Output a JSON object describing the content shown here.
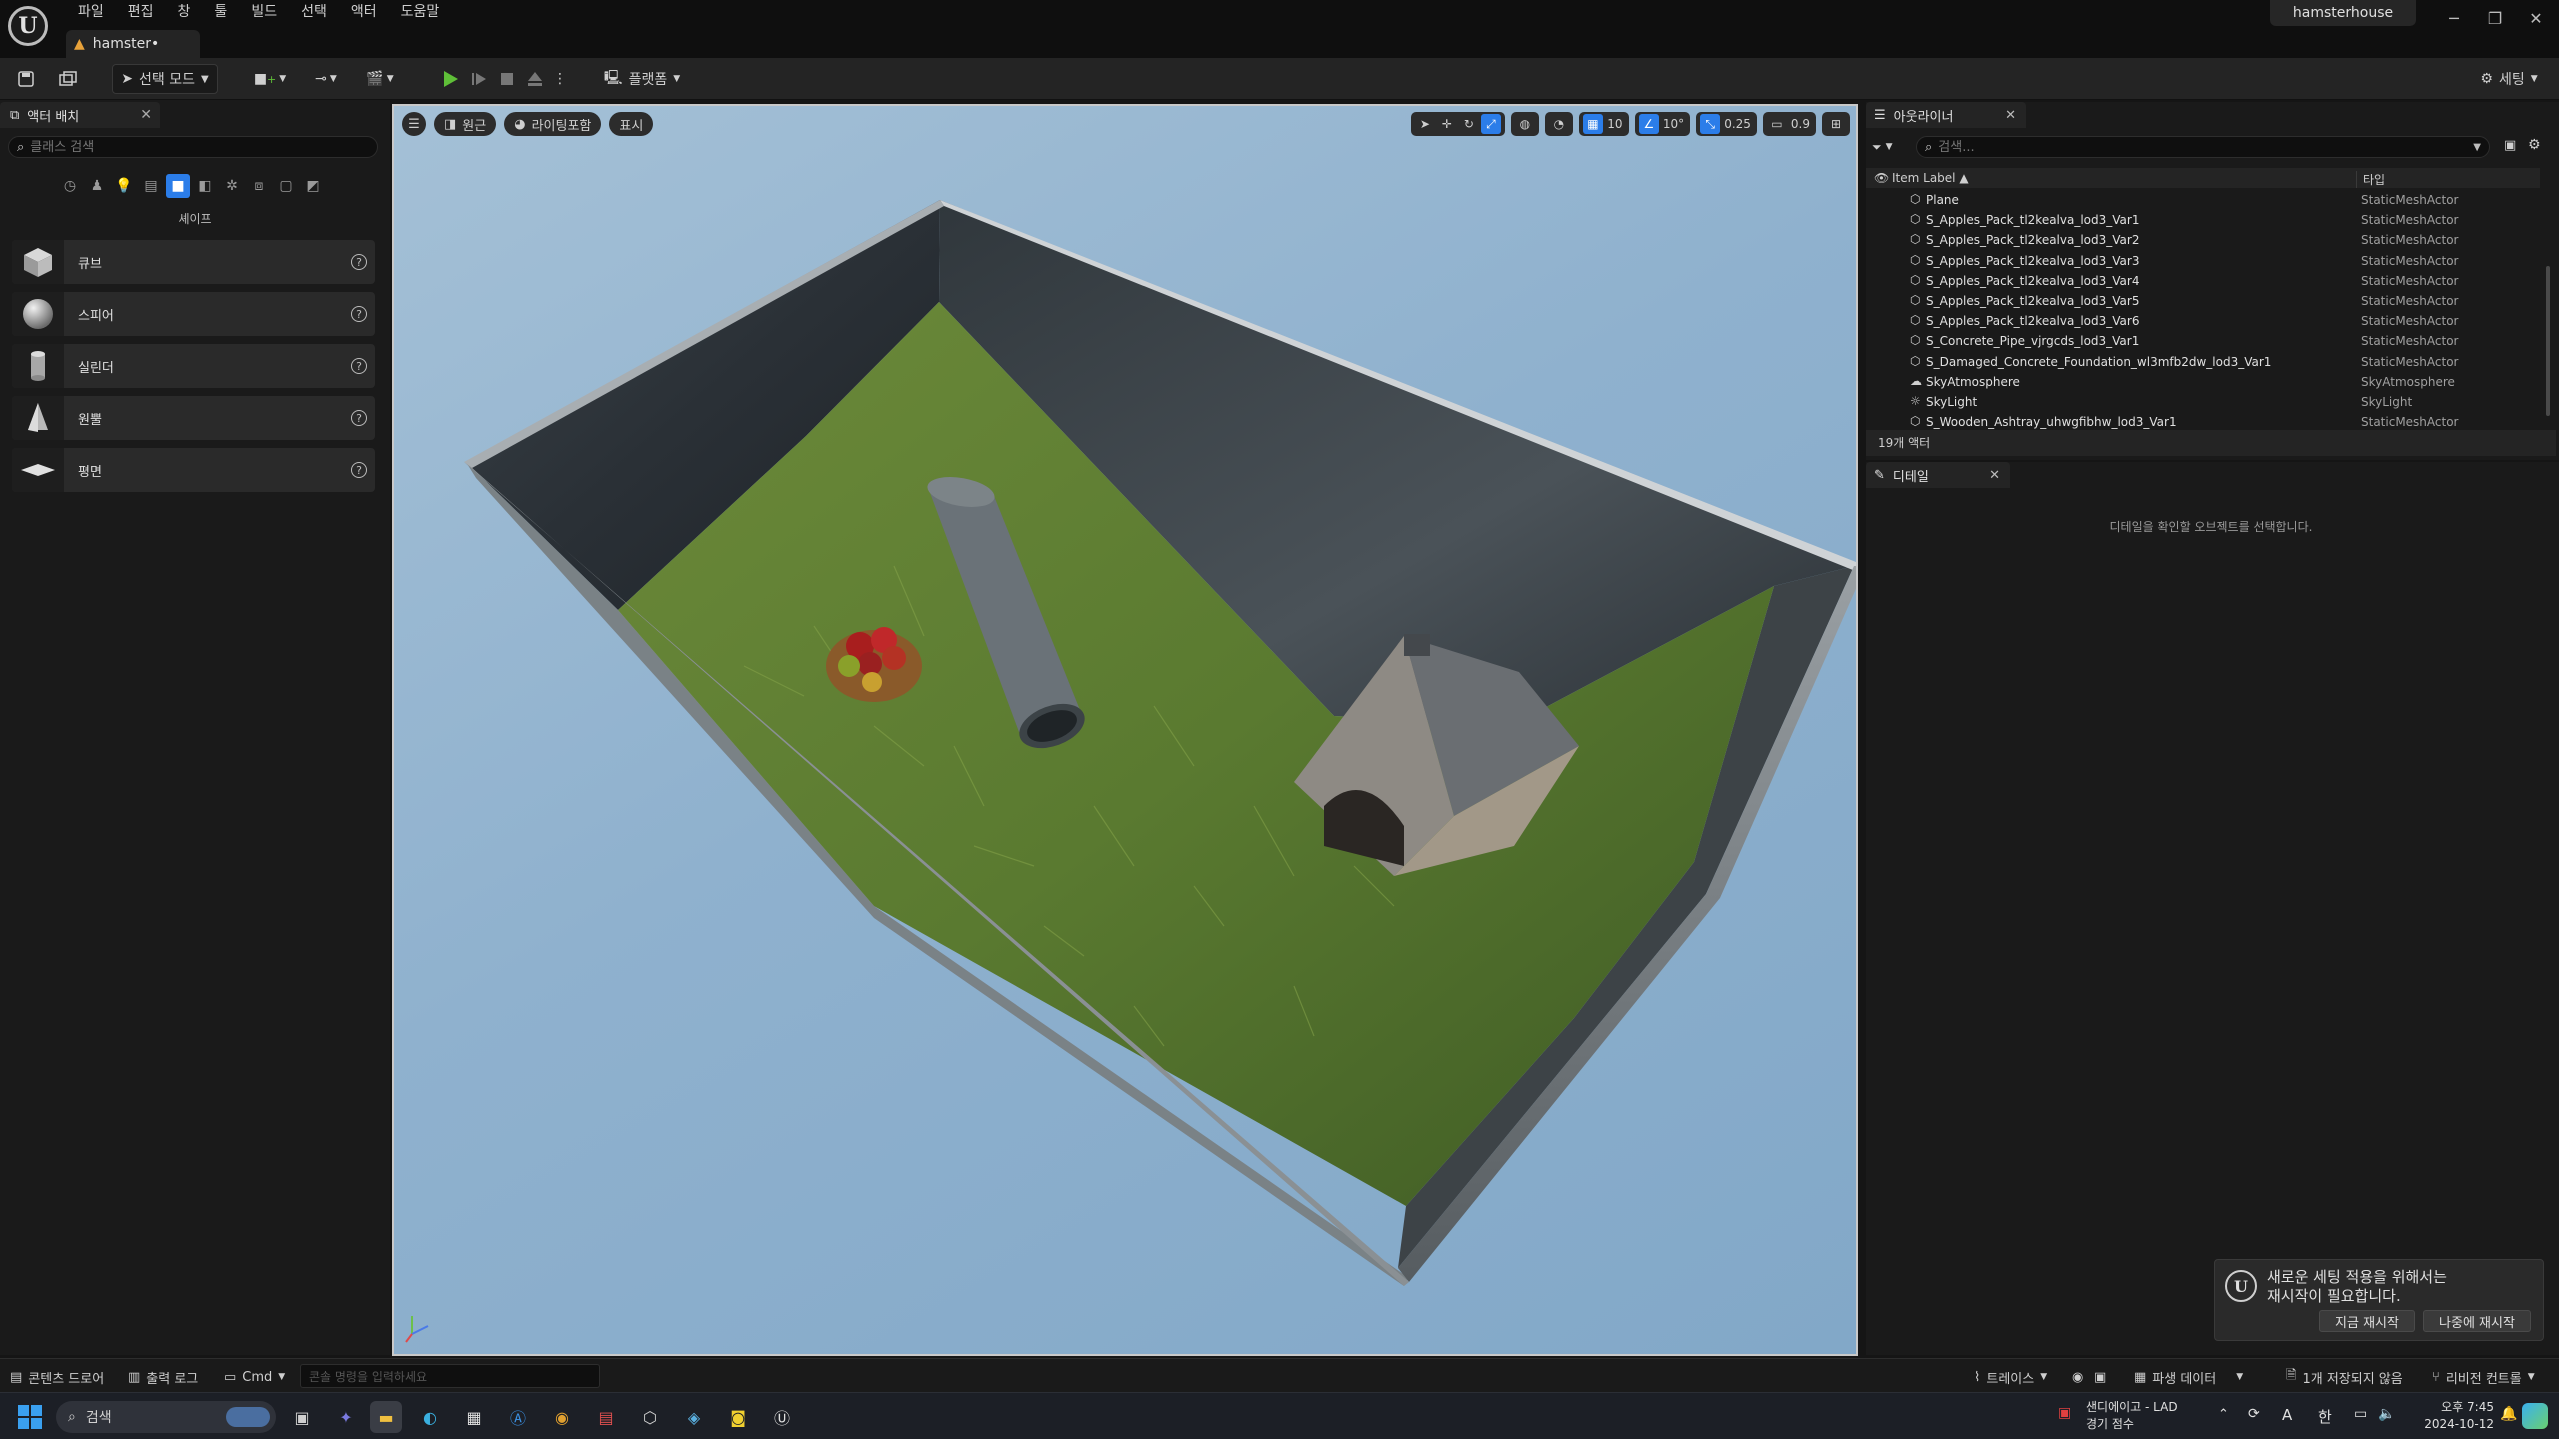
{
  "titlebar": {
    "menu": [
      "파일",
      "편집",
      "창",
      "툴",
      "빌드",
      "선택",
      "액터",
      "도움말"
    ],
    "project_tab": "hamster•",
    "project_name": "hamsterhouse"
  },
  "toolbar": {
    "select_mode": "선택 모드",
    "platforms": "플랫폼",
    "settings": "세팅"
  },
  "place_actors": {
    "tab_title": "액터 배치",
    "search_placeholder": "클래스 검색",
    "category_label": "셰이프",
    "shapes": [
      {
        "name": "큐브",
        "icon": "cube-icon"
      },
      {
        "name": "스피어",
        "icon": "sphere-icon"
      },
      {
        "name": "실린더",
        "icon": "cylinder-icon"
      },
      {
        "name": "원뿔",
        "icon": "cone-icon"
      },
      {
        "name": "평면",
        "icon": "plane-icon"
      }
    ]
  },
  "viewport": {
    "view_mode": "원근",
    "lighting": "라이팅포함",
    "show": "표시",
    "grid_snap": "10",
    "rotation_snap": "10°",
    "scale_snap": "0.25",
    "camera_speed": "0.9"
  },
  "outliner": {
    "tab_title": "아웃라이너",
    "search_placeholder": "검색...",
    "col_label": "Item Label ▲",
    "col_type": "타입",
    "rows": [
      {
        "label": "Plane",
        "type": "StaticMeshActor"
      },
      {
        "label": "S_Apples_Pack_tl2kealva_lod3_Var1",
        "type": "StaticMeshActor"
      },
      {
        "label": "S_Apples_Pack_tl2kealva_lod3_Var2",
        "type": "StaticMeshActor"
      },
      {
        "label": "S_Apples_Pack_tl2kealva_lod3_Var3",
        "type": "StaticMeshActor"
      },
      {
        "label": "S_Apples_Pack_tl2kealva_lod3_Var4",
        "type": "StaticMeshActor"
      },
      {
        "label": "S_Apples_Pack_tl2kealva_lod3_Var5",
        "type": "StaticMeshActor"
      },
      {
        "label": "S_Apples_Pack_tl2kealva_lod3_Var6",
        "type": "StaticMeshActor"
      },
      {
        "label": "S_Concrete_Pipe_vjrgcds_lod3_Var1",
        "type": "StaticMeshActor"
      },
      {
        "label": "S_Damaged_Concrete_Foundation_wl3mfb2dw_lod3_Var1",
        "type": "StaticMeshActor"
      },
      {
        "label": "SkyAtmosphere",
        "type": "SkyAtmosphere"
      },
      {
        "label": "SkyLight",
        "type": "SkyLight"
      },
      {
        "label": "S_Wooden_Ashtray_uhwgfibhw_lod3_Var1",
        "type": "StaticMeshActor"
      }
    ],
    "count": "19개 액터"
  },
  "details": {
    "tab_title": "디테일",
    "empty_message": "디테일을 확인할 오브젝트를 선택합니다."
  },
  "toast": {
    "message_line1": "새로운 세팅 적용을 위해서는",
    "message_line2": "재시작이 필요합니다.",
    "restart_now": "지금 재시작",
    "restart_later": "나중에 재시작"
  },
  "statusbar": {
    "content_drawer": "콘텐츠 드로어",
    "output_log": "출력 로그",
    "cmd": "Cmd",
    "console_placeholder": "콘솔 명령을 입력하세요",
    "trace": "트레이스",
    "derived_data": "파생 데이터",
    "unsaved": "1개 저장되지 않음",
    "revision_control": "리비전 컨트롤"
  },
  "taskbar": {
    "search": "검색",
    "notif_title": "샌디에이고 - LAD",
    "notif_sub": "경기 점수",
    "ime": "A",
    "lang": "한",
    "time": "오후 7:45",
    "date": "2024-10-12"
  },
  "colors": {
    "accent": "#2b7de9",
    "play": "#5fbf38",
    "panel": "#1a1a1a"
  }
}
